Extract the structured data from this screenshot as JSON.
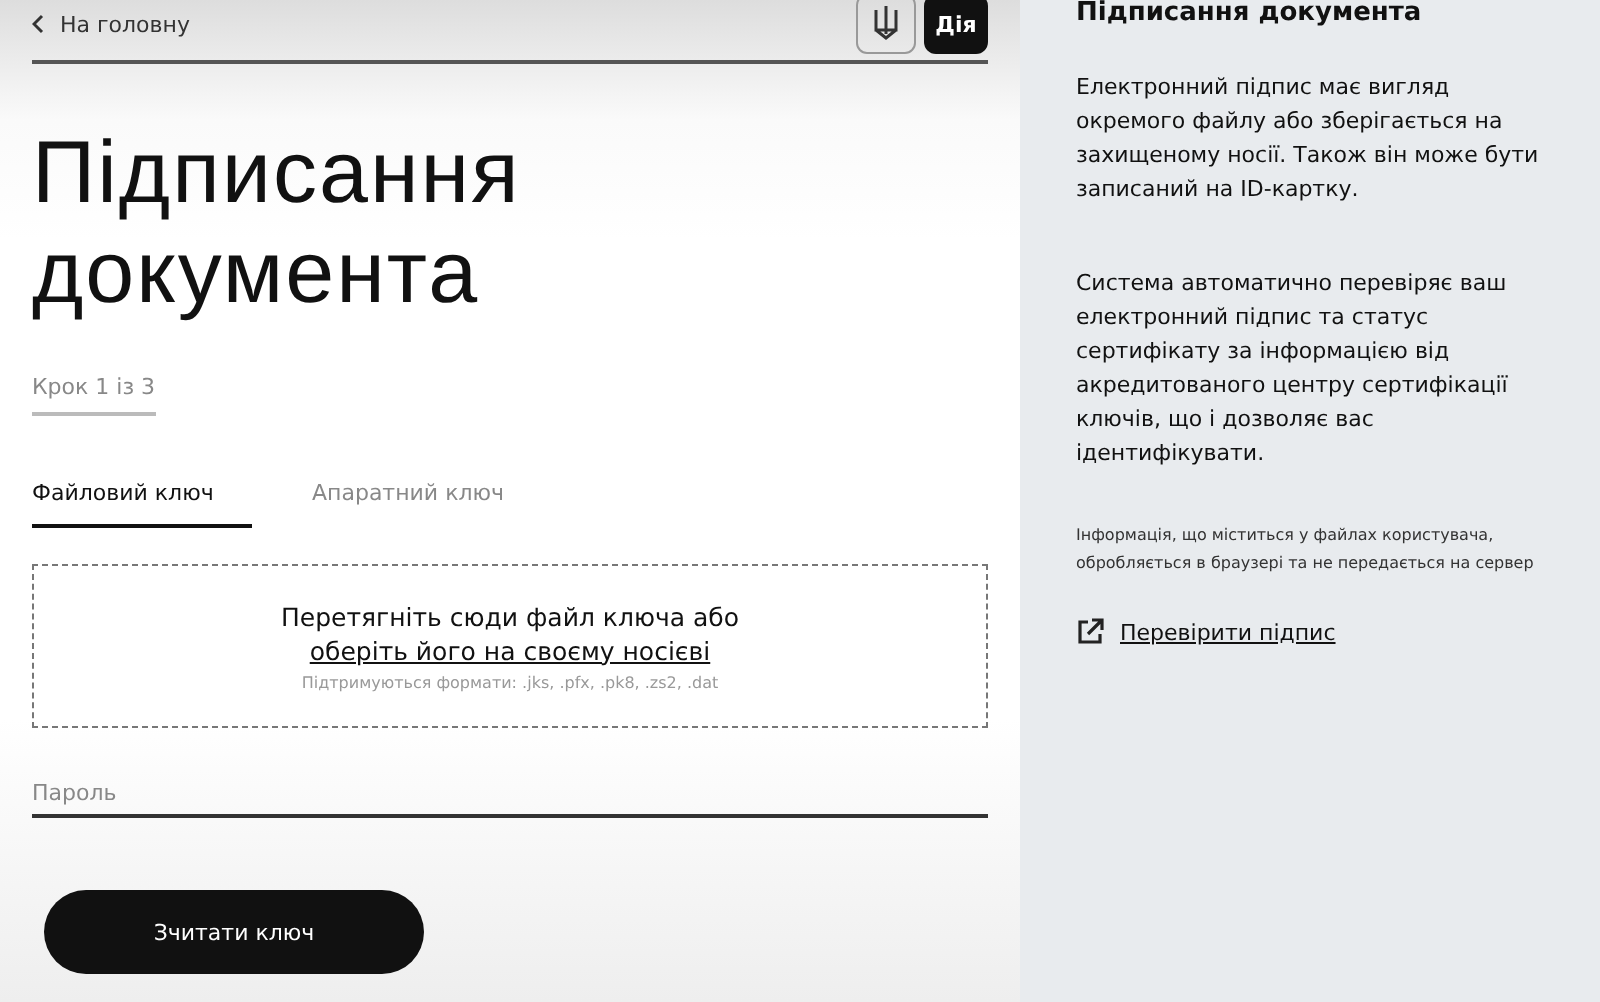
{
  "header": {
    "back_link": "На головну",
    "logo": "Дія"
  },
  "title": "Підписання документа",
  "step": "Крок 1 із 3",
  "tabs": [
    {
      "label": "Файловий ключ",
      "selected": true
    },
    {
      "label": "Апаратний ключ",
      "selected": false
    }
  ],
  "dropzone": {
    "text": "Перетягніть сюди файл ключа або",
    "link": "оберіть його на своєму носієві",
    "formats": "Підтримуються формати: .jks, .pfx, .pk8, .zs2, .dat"
  },
  "password": {
    "placeholder": "Пароль"
  },
  "button": "Зчитати ключ",
  "sidebar": {
    "title": "Підписання документа",
    "paragraphs": [
      "Електронний підпис має вигляд окремого файлу або зберігається на захищеному носії. Також він може бути записаний на ID-картку.",
      "Система автоматично перевіряє ваш електронний підпис та статус сертифікату за інформацією від акредитованого центру сертифікації ключів, що і дозволяє вас ідентифікувати."
    ],
    "note": "Інформація, що міститься у файлах користувача, обробляється в браузері та не передається на сервер",
    "link": "Перевірити підпис"
  }
}
